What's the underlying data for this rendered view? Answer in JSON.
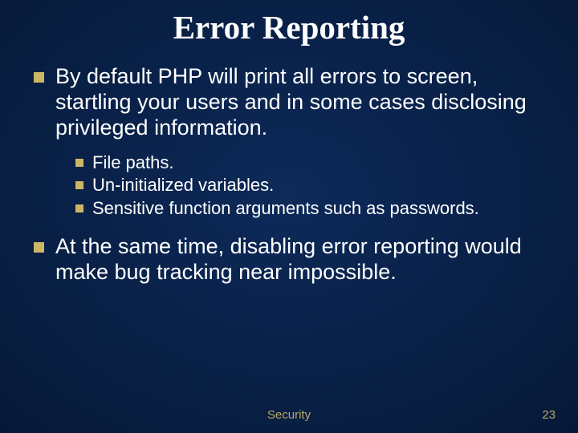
{
  "title": "Error Reporting",
  "bullets": {
    "b1": "By default PHP will print all errors to screen, startling your users and in some cases disclosing privileged information.",
    "sub1": "File paths.",
    "sub2": "Un-initialized variables.",
    "sub3": "Sensitive function arguments such as passwords.",
    "b2": "At the same time, disabling error reporting would make bug tracking near impossible."
  },
  "footer": {
    "center": "Security",
    "page": "23"
  }
}
